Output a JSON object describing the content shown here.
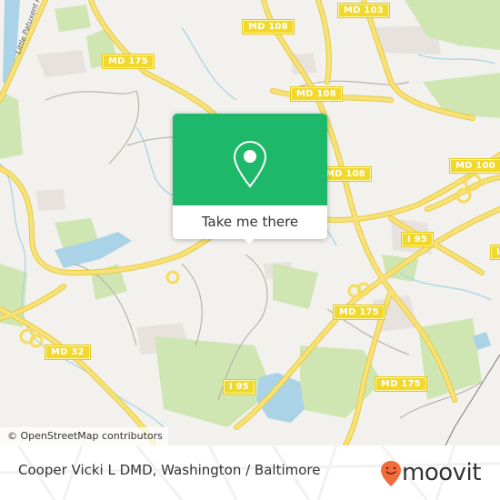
{
  "map": {
    "colors": {
      "background": "#f2f1ee",
      "road_major": "#f4dc5c",
      "road_casing": "#e8c93a",
      "road_minor": "#b9b3ad",
      "water": "#aad3e8",
      "park": "#cfe6b3",
      "urban": "#e8e2de"
    },
    "labels": {
      "river": "Little Patuxent R"
    },
    "shields": [
      {
        "id": "md108-top",
        "text": "MD 108"
      },
      {
        "id": "md103",
        "text": "MD 103"
      },
      {
        "id": "md175-top-left",
        "text": "MD 175"
      },
      {
        "id": "md108-mid",
        "text": "MD 108"
      },
      {
        "id": "md108-right",
        "text": "MD 108"
      },
      {
        "id": "md100",
        "text": "MD 100"
      },
      {
        "id": "us-right",
        "text": "US"
      },
      {
        "id": "i95-right",
        "text": "I 95"
      },
      {
        "id": "md175-center",
        "text": "MD 175"
      },
      {
        "id": "md32",
        "text": "MD 32"
      },
      {
        "id": "i95-bottom",
        "text": "I 95"
      },
      {
        "id": "md175-bottom",
        "text": "MD 175"
      },
      {
        "id": "hidden-shield",
        "text": ""
      }
    ],
    "attribution": "© OpenStreetMap contributors"
  },
  "popup": {
    "accent": "#1db86a",
    "icon": "map-pin-icon",
    "button_label": "Take me there"
  },
  "footer": {
    "place_title": "Cooper Vicki L DMD, Washington / Baltimore",
    "brand": {
      "name": "moovit",
      "icon": "moovit-smile-pin-icon",
      "icon_color": "#f26b3a"
    }
  }
}
